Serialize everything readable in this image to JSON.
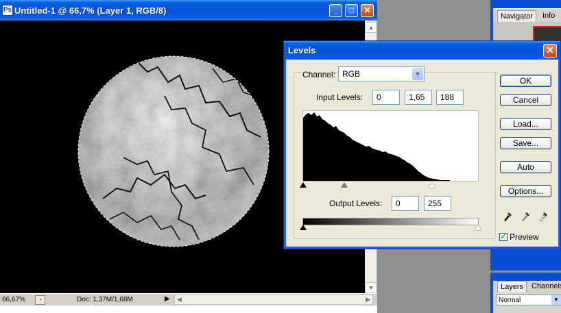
{
  "document": {
    "title": "Untitled-1 @ 66,7% (Layer 1, RGB/8)",
    "minimize_label": "_",
    "maximize_label": "□",
    "close_label": "✕",
    "status": {
      "zoom": "66,67%",
      "doc_info": "Doc: 1,37M/1,68M"
    }
  },
  "panels": {
    "navigator_tabs": [
      "Navigator",
      "Info"
    ],
    "layers_tabs": [
      "Layers",
      "Channels"
    ],
    "blend_mode": "Normal"
  },
  "levels": {
    "title": "Levels",
    "channel_label": "Channel:",
    "channel_value": "RGB",
    "input_levels_label": "Input Levels:",
    "input_black": "0",
    "input_gamma": "1,65",
    "input_white": "188",
    "output_levels_label": "Output Levels:",
    "output_black": "0",
    "output_white": "255",
    "buttons": {
      "ok": "OK",
      "cancel": "Cancel",
      "load": "Load...",
      "save": "Save...",
      "auto": "Auto",
      "options": "Options..."
    },
    "preview_label": "Preview",
    "preview_checked": true,
    "input_slider_positions": {
      "black": 0,
      "gamma": 1.65,
      "white": 188
    },
    "output_slider_positions": {
      "black": 0,
      "white": 255
    },
    "colors": {
      "titlebar": "#0554d8",
      "dialog_bg": "#ece9d8"
    }
  }
}
